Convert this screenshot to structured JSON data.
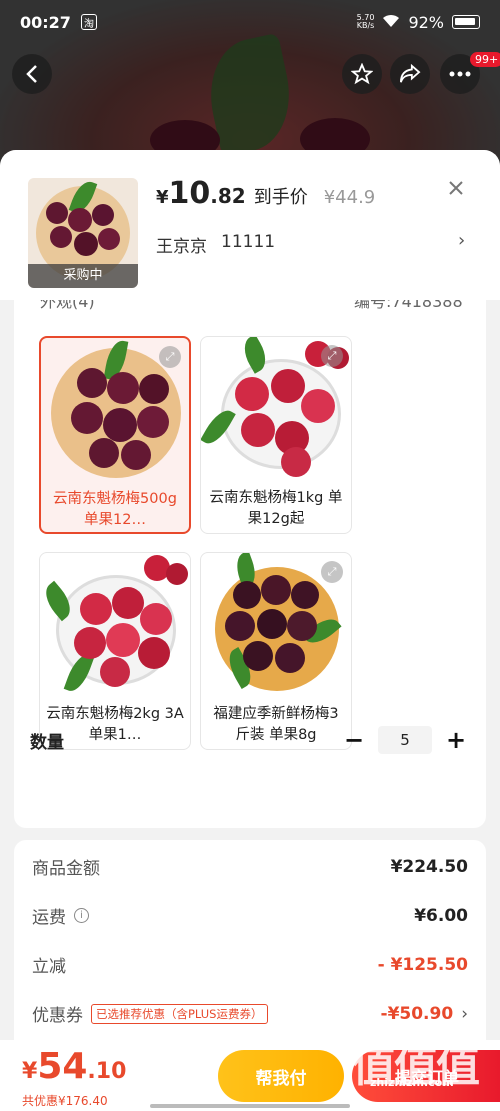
{
  "status_bar": {
    "time": "00:27",
    "app_badge": "淘",
    "net_speed": "5.70\nKB/s",
    "battery": "92%"
  },
  "top_bar": {
    "back_icon": "back-arrow-icon",
    "fav_icon": "star-icon",
    "share_icon": "share-icon",
    "more_icon": "more-icon",
    "badge": "99+"
  },
  "sheet": {
    "thumb_label": "采购中",
    "price": {
      "currency": "¥",
      "integer": "10",
      "decimal": ".82",
      "tag": "到手价",
      "original": "¥44.9"
    },
    "seller_name": "王京京",
    "seller_id": "11111",
    "cut_left": "外观(4)",
    "cut_right": "编号:7418388",
    "skus": [
      {
        "name": "云南东魁杨梅500g 单果12…",
        "selected": true
      },
      {
        "name": "云南东魁杨梅1kg 单果12g起",
        "selected": false
      },
      {
        "name": "云南东魁杨梅2kg 3A单果1…",
        "selected": false
      },
      {
        "name": "福建应季新鲜杨梅3斤装 单果8g",
        "selected": false
      }
    ],
    "quantity": {
      "label": "数量",
      "minus": "−",
      "value": "5",
      "plus": "+"
    }
  },
  "fees": {
    "goods_label": "商品金额",
    "goods_value": "¥224.50",
    "shipping_label": "运费",
    "shipping_value": "¥6.00",
    "discount_label": "立减",
    "discount_value": "- ¥125.50",
    "coupon_label": "优惠券",
    "coupon_tag": "已选推荐优惠（含PLUS运费券）",
    "coupon_value": "-¥50.90"
  },
  "bottom": {
    "currency": "¥",
    "total_int": "54",
    "total_dec": ".10",
    "saving": "共优惠¥176.40",
    "help_btn": "帮我付",
    "submit_btn": "提交订单"
  },
  "watermark": {
    "text": "值值值",
    "sub": "zhizhizhi.com"
  },
  "colors": {
    "accent": "#e8492c",
    "help": "#ffb200",
    "submit": "#e8192c"
  }
}
